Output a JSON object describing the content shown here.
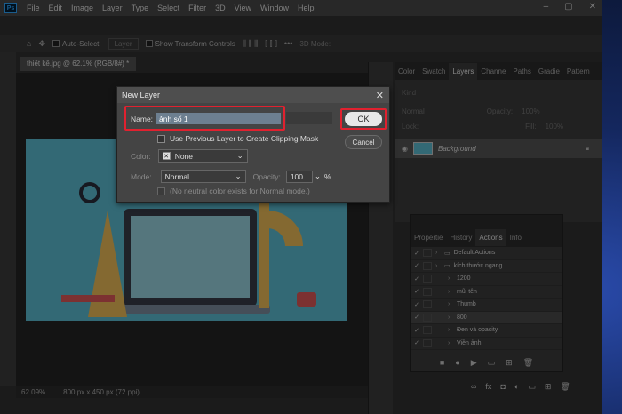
{
  "menu": {
    "logo": "Ps",
    "items": [
      "File",
      "Edit",
      "Image",
      "Layer",
      "Type",
      "Select",
      "Filter",
      "3D",
      "View",
      "Window",
      "Help"
    ]
  },
  "options": {
    "auto_select": "Auto-Select:",
    "layer_dd": "Layer",
    "show_transform": "Show Transform Controls",
    "mode_3d": "3D Mode:"
  },
  "document": {
    "tab": "thiết kế.jpg @ 62.1% (RGB/8#) *",
    "zoom": "62.09%",
    "size": "800 px x 450 px (72 ppi)"
  },
  "layers_panel": {
    "tabs": [
      "Color",
      "Swatch",
      "Layers",
      "Channe",
      "Paths",
      "Gradie",
      "Pattern"
    ],
    "active_tab": "Layers",
    "kind": "Kind",
    "mode": "Normal",
    "opacity_label": "Opacity:",
    "opacity": "100%",
    "lock_label": "Lock:",
    "fill_label": "Fill:",
    "fill": "100%",
    "layer_name": "Background"
  },
  "actions_panel": {
    "tabs": [
      "Propertie",
      "History",
      "Actions",
      "Info"
    ],
    "active_tab": "Actions",
    "rows": [
      {
        "label": "Default Actions",
        "folder": true
      },
      {
        "label": "kích thước ngang",
        "folder": true
      },
      {
        "label": "1200",
        "folder": false
      },
      {
        "label": "mũi tên",
        "folder": false
      },
      {
        "label": "Thumb",
        "folder": false
      },
      {
        "label": "800",
        "folder": false
      },
      {
        "label": "Đen và opacity",
        "folder": false
      },
      {
        "label": "Viền ảnh",
        "folder": false
      }
    ]
  },
  "dialog": {
    "title": "New Layer",
    "name_label": "Name:",
    "name_value": "ảnh số 1",
    "clipping_label": "Use Previous Layer to Create Clipping Mask",
    "color_label": "Color:",
    "color_value": "None",
    "mode_label": "Mode:",
    "mode_value": "Normal",
    "opacity_label": "Opacity:",
    "opacity_value": "100",
    "opacity_unit": "%",
    "neutral_label": "(No neutral color exists for Normal mode.)",
    "ok": "OK",
    "cancel": "Cancel",
    "highlight_color": "#e0212f"
  }
}
